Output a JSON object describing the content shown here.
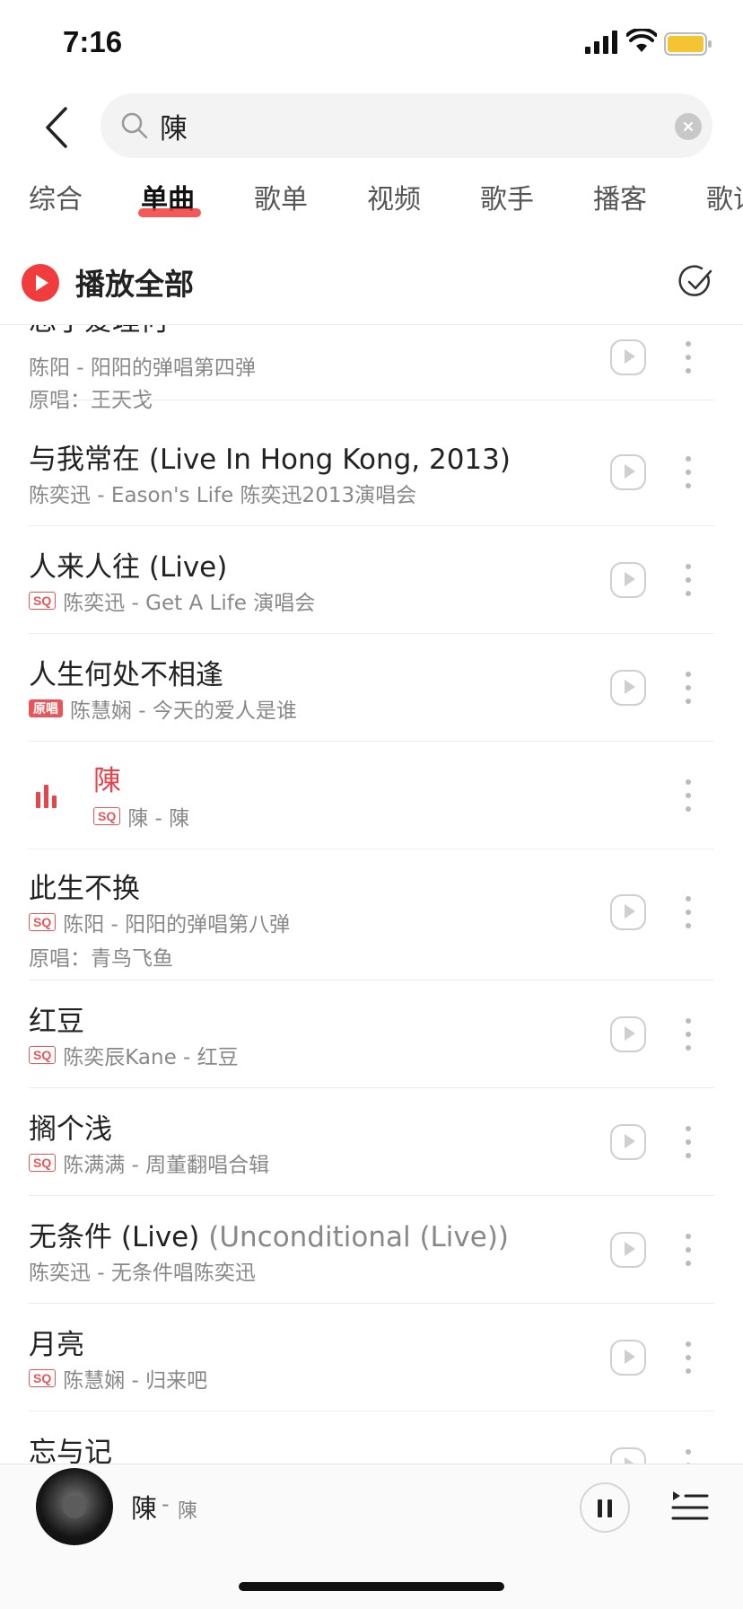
{
  "status_bar": {
    "time": "7:16"
  },
  "search": {
    "query": "陳"
  },
  "tabs": [
    {
      "label": "综合",
      "active": false
    },
    {
      "label": "单曲",
      "active": true
    },
    {
      "label": "歌单",
      "active": false
    },
    {
      "label": "视频",
      "active": false
    },
    {
      "label": "歌手",
      "active": false
    },
    {
      "label": "播客",
      "active": false
    },
    {
      "label": "歌词",
      "active": false
    }
  ],
  "play_all": {
    "label": "播放全部"
  },
  "songs": [
    {
      "title": "忘了爱理何",
      "subtitle": "陈阳 - 阳阳的弹唱第四弹",
      "original": "原唱：王天戈",
      "badge": ""
    },
    {
      "title": "与我常在 (Live In Hong Kong, 2013)",
      "subtitle": "陈奕迅 - Eason's Life 陈奕迅2013演唱会",
      "original": "",
      "badge": ""
    },
    {
      "title": "人来人往 (Live)",
      "subtitle": "陈奕迅 - Get A Life 演唱会",
      "original": "",
      "badge": "SQ"
    },
    {
      "title": "人生何处不相逢",
      "subtitle": "陈慧娴 - 今天的爱人是谁",
      "original": "",
      "badge": "原唱"
    },
    {
      "title": "陳",
      "subtitle": "陳 - 陳",
      "original": "",
      "badge": "SQ",
      "playing": true
    },
    {
      "title": "此生不换",
      "subtitle": "陈阳 - 阳阳的弹唱第八弹",
      "original": "原唱：青鸟飞鱼",
      "badge": "SQ"
    },
    {
      "title": "红豆",
      "subtitle": "陈奕辰Kane - 红豆",
      "original": "",
      "badge": "SQ"
    },
    {
      "title": "搁个浅",
      "subtitle": "陈满满 - 周董翻唱合辑",
      "original": "",
      "badge": "SQ"
    },
    {
      "title": "无条件 (Live)",
      "title_alt": "(Unconditional (Live))",
      "subtitle": "陈奕迅 - 无条件唱陈奕迅",
      "original": "",
      "badge": ""
    },
    {
      "title": "月亮",
      "subtitle": "陈慧娴 - 归来吧",
      "original": "",
      "badge": "SQ"
    },
    {
      "title": "忘与记",
      "subtitle": "",
      "original": "",
      "badge": ""
    }
  ],
  "now_playing": {
    "title": "陳",
    "separator": "-",
    "artist": "陳"
  },
  "colors": {
    "accent": "#f03c3c",
    "badge": "#e8565a"
  }
}
